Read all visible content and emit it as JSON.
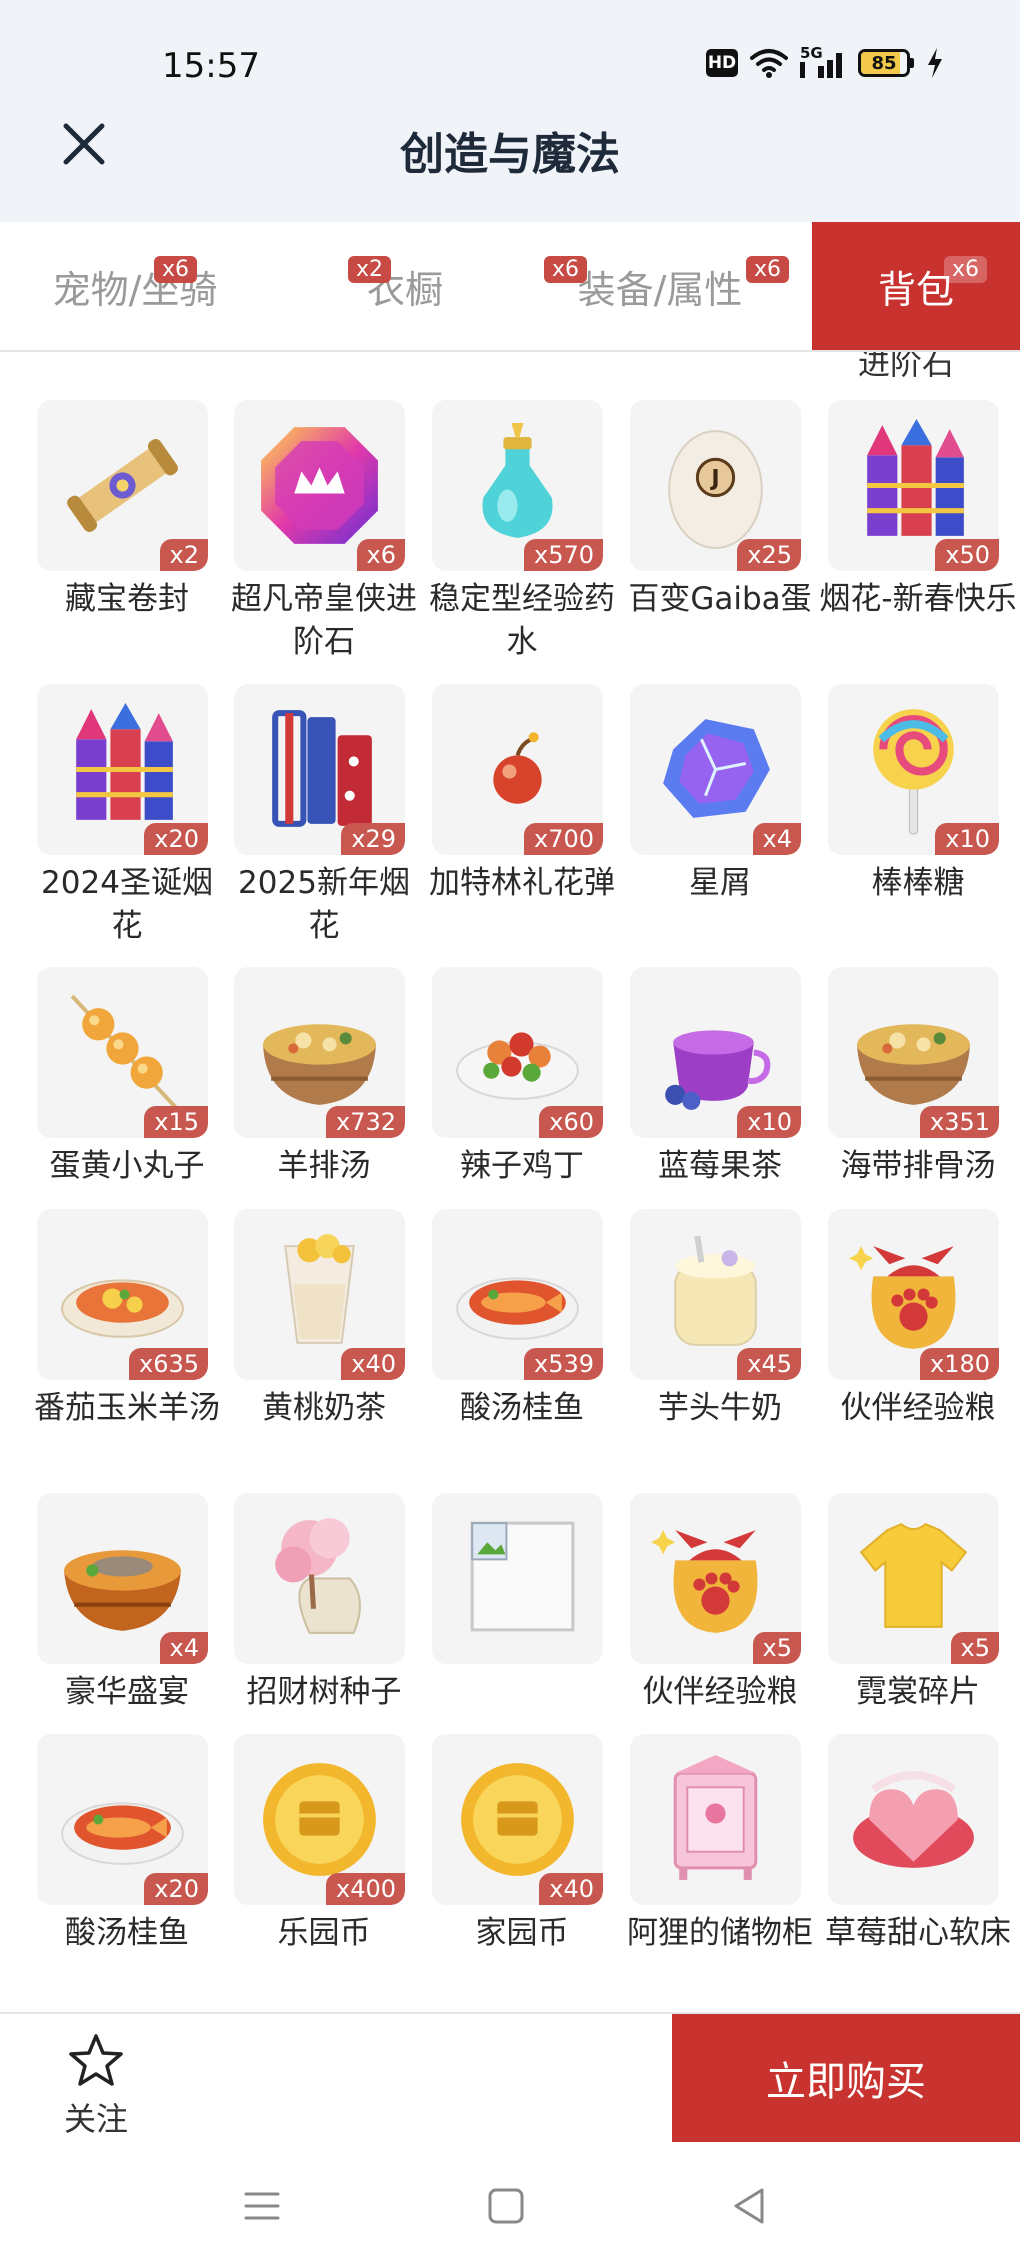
{
  "status": {
    "time": "15:57",
    "hd": "HD",
    "network": "5G",
    "battery": "85",
    "battery_level": 0.85
  },
  "header": {
    "title": "创造与魔法"
  },
  "tabs": [
    {
      "label": "宠物/坐骑",
      "badge": "x6"
    },
    {
      "label": "衣橱",
      "badge": "x2"
    },
    {
      "label": "装备/属性",
      "badge": "x6"
    },
    {
      "label": "背包",
      "badge": "x6",
      "badge2": "x6",
      "active": true
    }
  ],
  "partial_item_label": "进阶石",
  "items": [
    {
      "name": "藏宝卷封",
      "qty": "x2",
      "icon": "scroll-icon"
    },
    {
      "name": "超凡帝皇侠进阶石",
      "qty": "x6",
      "icon": "gem-icon"
    },
    {
      "name": "稳定型经验药水",
      "qty": "x570",
      "icon": "potion-icon"
    },
    {
      "name": "百变Gaiba蛋",
      "qty": "x25",
      "icon": "egg-icon"
    },
    {
      "name": "烟花-新春快乐",
      "qty": "x50",
      "icon": "firework-icon"
    },
    {
      "name": "2024圣诞烟花",
      "qty": "x20",
      "icon": "firework-icon"
    },
    {
      "name": "2025新年烟花",
      "qty": "x29",
      "icon": "firecracker-icon"
    },
    {
      "name": "加特林礼花弹",
      "qty": "x700",
      "icon": "bomb-icon"
    },
    {
      "name": "星屑",
      "qty": "x4",
      "icon": "crystal-icon"
    },
    {
      "name": "棒棒糖",
      "qty": "x10",
      "icon": "lollipop-icon"
    },
    {
      "name": "蛋黄小丸子",
      "qty": "x15",
      "icon": "skewer-icon"
    },
    {
      "name": "羊排汤",
      "qty": "x732",
      "icon": "soup-bowl-icon"
    },
    {
      "name": "辣子鸡丁",
      "qty": "x60",
      "icon": "dish-plate-icon"
    },
    {
      "name": "蓝莓果茶",
      "qty": "x10",
      "icon": "tea-cup-icon"
    },
    {
      "name": "海带排骨汤",
      "qty": "x351",
      "icon": "soup-bowl-icon"
    },
    {
      "name": "番茄玉米羊汤",
      "qty": "x635",
      "icon": "casserole-icon"
    },
    {
      "name": "黄桃奶茶",
      "qty": "x40",
      "icon": "milk-tea-icon"
    },
    {
      "name": "酸汤桂鱼",
      "qty": "x539",
      "icon": "fish-dish-icon"
    },
    {
      "name": "芋头牛奶",
      "qty": "x45",
      "icon": "milk-jar-icon"
    },
    {
      "name": "伙伴经验粮",
      "qty": "x180",
      "icon": "paw-bag-icon"
    },
    {
      "name": "豪华盛宴",
      "qty": "x4",
      "icon": "feast-bowl-icon"
    },
    {
      "name": "招财树种子",
      "qty": "",
      "icon": "seed-bag-icon"
    },
    {
      "name": "",
      "qty": "",
      "icon": "broken-image-icon"
    },
    {
      "name": "伙伴经验粮",
      "qty": "x5",
      "icon": "paw-bag-icon"
    },
    {
      "name": "霓裳碎片",
      "qty": "x5",
      "icon": "shirt-icon"
    },
    {
      "name": "酸汤桂鱼",
      "qty": "x20",
      "icon": "fish-dish-icon"
    },
    {
      "name": "乐园币",
      "qty": "x400",
      "icon": "coin-icon"
    },
    {
      "name": "家园币",
      "qty": "x40",
      "icon": "coin-icon"
    },
    {
      "name": "阿狸的储物柜",
      "qty": "",
      "icon": "cabinet-icon"
    },
    {
      "name": "草莓甜心软床",
      "qty": "",
      "icon": "bed-icon"
    }
  ],
  "bottom": {
    "follow_label": "关注",
    "buy_label": "立即购买"
  },
  "colors": {
    "accent": "#c8322f",
    "badge": "#c8574f",
    "header_bg": "#f0f4f8",
    "card_bg": "#f4f4f4"
  }
}
